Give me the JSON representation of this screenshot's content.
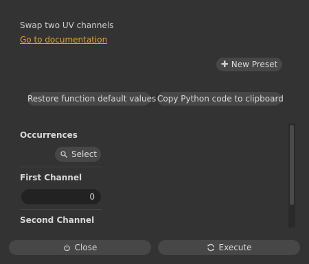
{
  "header": {
    "description": "Swap two UV channels",
    "doc_link": "Go to documentation"
  },
  "presets": {
    "new_preset_label": "New Preset"
  },
  "actions": {
    "restore_label": "Restore function default values",
    "copy_python_label": "Copy Python code to clipboard"
  },
  "params": {
    "occurrences": {
      "label": "Occurrences",
      "select_label": "Select"
    },
    "first_channel": {
      "label": "First Channel",
      "value": "0"
    },
    "second_channel": {
      "label": "Second Channel"
    }
  },
  "footer": {
    "close_label": "Close",
    "execute_label": "Execute"
  },
  "icons": {
    "new_preset": "plus-icon",
    "select": "search-icon",
    "close": "power-icon",
    "execute": "refresh-icon"
  },
  "colors": {
    "background": "#333333",
    "button": "#474747",
    "input": "#222222",
    "link": "#e8a321",
    "text": "#d2d2d2"
  }
}
